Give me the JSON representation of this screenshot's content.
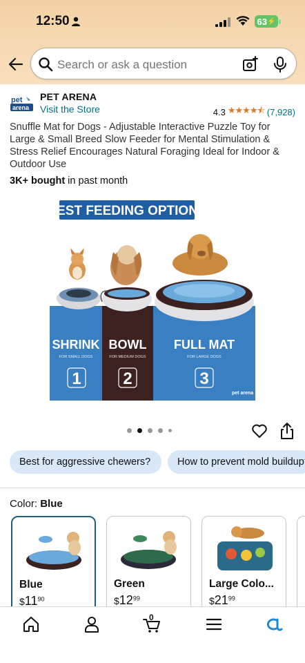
{
  "status_bar": {
    "time": "12:50",
    "battery": "63"
  },
  "search": {
    "placeholder": "Search or ask a question"
  },
  "store": {
    "logo_text": "pet arena",
    "name": "PET ARENA",
    "visit_label": "Visit the Store",
    "rating": "4.3",
    "rating_count": "(7,928)"
  },
  "product": {
    "title": "Snuffle Mat for Dogs - Adjustable Interactive Puzzle Toy for Large & Small Breed Slow Feeder for Mental Stimulation & Stress Relief Encourages Natural Foraging Ideal for Indoor & Outdoor Use",
    "bought_bold": "3K+ bought",
    "bought_rest": " in past month"
  },
  "image": {
    "banner": "BEST FEEDING OPTIONS",
    "panels": [
      {
        "label": "SHRINK",
        "sub": "FOR SMALL DOGS",
        "num": "1"
      },
      {
        "label": "BOWL",
        "sub": "FOR MEDIUM DOGS",
        "num": "2"
      },
      {
        "label": "FULL MAT",
        "sub": "FOR LARGE DOGS",
        "num": "3"
      }
    ],
    "logo": "pet arena"
  },
  "carousel": {
    "total": 5,
    "active_index": 1
  },
  "chips": [
    "Best for aggressive chewers?",
    "How to prevent mold buildup?"
  ],
  "color": {
    "label": "Color:",
    "selected": "Blue"
  },
  "variants": [
    {
      "name": "Blue",
      "dollars": "11",
      "cents": "90",
      "selected": true
    },
    {
      "name": "Green",
      "dollars": "12",
      "cents": "99",
      "selected": false
    },
    {
      "name": "Large Colo...",
      "dollars": "21",
      "cents": "99",
      "selected": false
    }
  ],
  "cart": {
    "count": "0"
  },
  "colors": {
    "accent": "#007185",
    "star": "#de7921",
    "chip_bg": "#d8e8f8",
    "selected_border": "#1b5f82",
    "image_blue": "#3a7fc1",
    "image_brown": "#3b2220"
  }
}
